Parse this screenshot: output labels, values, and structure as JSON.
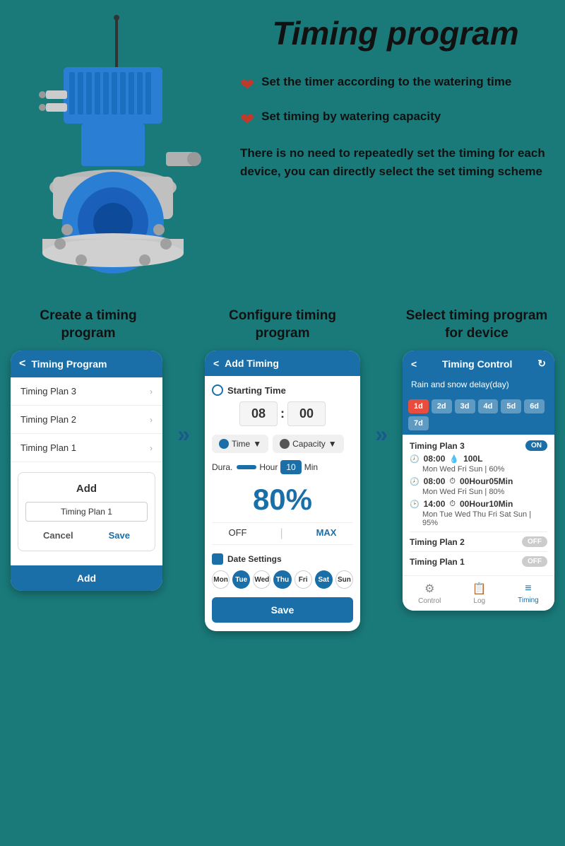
{
  "page": {
    "title": "Timing program",
    "background_color": "#1a7a7a"
  },
  "top_section": {
    "feature1": "Set the timer according to the watering time",
    "feature2": "Set timing by watering capacity",
    "description": "There is no need to repeatedly set the timing for each device, you can directly select the set timing scheme"
  },
  "steps": [
    {
      "label": "Create a timing program"
    },
    {
      "label": "Configure timing program"
    },
    {
      "label": "Select timing program for device"
    }
  ],
  "phone1": {
    "header_title": "Timing Program",
    "back_label": "<",
    "plans": [
      {
        "name": "Timing Plan 3"
      },
      {
        "name": "Timing Plan 2"
      },
      {
        "name": "Timing Plan 1"
      }
    ],
    "modal": {
      "title": "Add",
      "input_value": "Timing Plan 1",
      "cancel_label": "Cancel",
      "save_label": "Save"
    },
    "footer_add": "Add"
  },
  "phone2": {
    "header_title": "Add Timing",
    "back_label": "<",
    "starting_time_label": "Starting Time",
    "hour": "08",
    "minute": "00",
    "mode1": "Time",
    "mode2": "Capacity",
    "duration_label": "Dura.",
    "hour_label": "Hour",
    "min_value": "10",
    "min_label": "Min",
    "percent": "80%",
    "off_label": "OFF",
    "max_label": "MAX",
    "date_settings_label": "Date Settings",
    "days": [
      {
        "label": "Mon",
        "active": false
      },
      {
        "label": "Tue",
        "active": true
      },
      {
        "label": "Wed",
        "active": false
      },
      {
        "label": "Thu",
        "active": true
      },
      {
        "label": "Fri",
        "active": false
      },
      {
        "label": "Sat",
        "active": true
      },
      {
        "label": "Sun",
        "active": false
      }
    ],
    "save_label": "Save"
  },
  "phone3": {
    "header_title": "Timing Control",
    "back_label": "<",
    "subheader": "Rain and snow delay(day)",
    "delay_days": [
      "1d",
      "2d",
      "3d",
      "4d",
      "5d",
      "6d",
      "7d"
    ],
    "active_delay": "1d",
    "plans": [
      {
        "name": "Timing Plan 3",
        "toggle": "ON",
        "active": true,
        "schedules": [
          {
            "clock_icon": "🕗",
            "time": "08:00",
            "capacity_icon": "💧",
            "capacity": "100L",
            "days_info": "Mon  Wed  Fri  Sun  |  60%"
          },
          {
            "clock_icon": "🕗",
            "time": "08:00",
            "capacity_icon": "⏱",
            "capacity": "00Hour05Min",
            "days_info": "Mon  Wed  Fri  Sun  |  80%"
          },
          {
            "clock_icon": "🕑",
            "time": "14:00",
            "capacity_icon": "⏱",
            "capacity": "00Hour10Min",
            "days_info": "Mon  Tue  Wed  Thu  Fri  Sat  Sun  |  95%"
          }
        ]
      },
      {
        "name": "Timing Plan 2",
        "toggle": "OFF",
        "active": false
      },
      {
        "name": "Timing Plan 1",
        "toggle": "OFF",
        "active": false
      }
    ],
    "footer": [
      {
        "icon": "⚙",
        "label": "Control",
        "active": false
      },
      {
        "icon": "📋",
        "label": "Log",
        "active": false
      },
      {
        "icon": "≡",
        "label": "Timing",
        "active": true
      }
    ]
  },
  "icons": {
    "heart": "❤",
    "arrow_right": "›",
    "double_arrow": "»",
    "back": "<",
    "refresh": "↻"
  }
}
